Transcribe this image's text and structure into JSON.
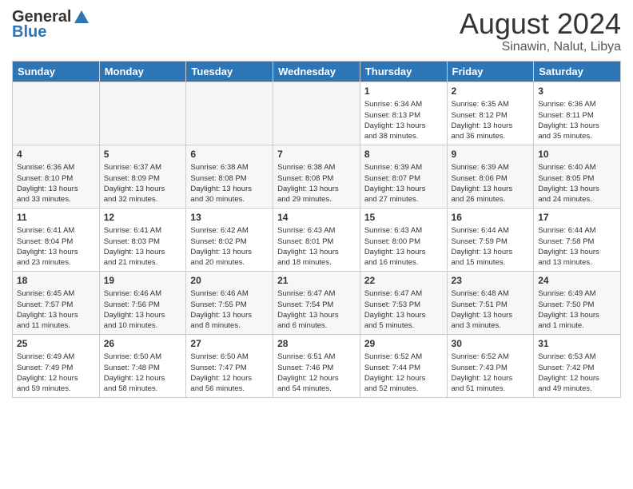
{
  "logo": {
    "general": "General",
    "blue": "Blue"
  },
  "header": {
    "month_year": "August 2024",
    "location": "Sinawin, Nalut, Libya"
  },
  "weekdays": [
    "Sunday",
    "Monday",
    "Tuesday",
    "Wednesday",
    "Thursday",
    "Friday",
    "Saturday"
  ],
  "weeks": [
    [
      {
        "day": "",
        "info": "",
        "empty": true
      },
      {
        "day": "",
        "info": "",
        "empty": true
      },
      {
        "day": "",
        "info": "",
        "empty": true
      },
      {
        "day": "",
        "info": "",
        "empty": true
      },
      {
        "day": "1",
        "info": "Sunrise: 6:34 AM\nSunset: 8:13 PM\nDaylight: 13 hours\nand 38 minutes."
      },
      {
        "day": "2",
        "info": "Sunrise: 6:35 AM\nSunset: 8:12 PM\nDaylight: 13 hours\nand 36 minutes."
      },
      {
        "day": "3",
        "info": "Sunrise: 6:36 AM\nSunset: 8:11 PM\nDaylight: 13 hours\nand 35 minutes."
      }
    ],
    [
      {
        "day": "4",
        "info": "Sunrise: 6:36 AM\nSunset: 8:10 PM\nDaylight: 13 hours\nand 33 minutes."
      },
      {
        "day": "5",
        "info": "Sunrise: 6:37 AM\nSunset: 8:09 PM\nDaylight: 13 hours\nand 32 minutes."
      },
      {
        "day": "6",
        "info": "Sunrise: 6:38 AM\nSunset: 8:08 PM\nDaylight: 13 hours\nand 30 minutes."
      },
      {
        "day": "7",
        "info": "Sunrise: 6:38 AM\nSunset: 8:08 PM\nDaylight: 13 hours\nand 29 minutes."
      },
      {
        "day": "8",
        "info": "Sunrise: 6:39 AM\nSunset: 8:07 PM\nDaylight: 13 hours\nand 27 minutes."
      },
      {
        "day": "9",
        "info": "Sunrise: 6:39 AM\nSunset: 8:06 PM\nDaylight: 13 hours\nand 26 minutes."
      },
      {
        "day": "10",
        "info": "Sunrise: 6:40 AM\nSunset: 8:05 PM\nDaylight: 13 hours\nand 24 minutes."
      }
    ],
    [
      {
        "day": "11",
        "info": "Sunrise: 6:41 AM\nSunset: 8:04 PM\nDaylight: 13 hours\nand 23 minutes."
      },
      {
        "day": "12",
        "info": "Sunrise: 6:41 AM\nSunset: 8:03 PM\nDaylight: 13 hours\nand 21 minutes."
      },
      {
        "day": "13",
        "info": "Sunrise: 6:42 AM\nSunset: 8:02 PM\nDaylight: 13 hours\nand 20 minutes."
      },
      {
        "day": "14",
        "info": "Sunrise: 6:43 AM\nSunset: 8:01 PM\nDaylight: 13 hours\nand 18 minutes."
      },
      {
        "day": "15",
        "info": "Sunrise: 6:43 AM\nSunset: 8:00 PM\nDaylight: 13 hours\nand 16 minutes."
      },
      {
        "day": "16",
        "info": "Sunrise: 6:44 AM\nSunset: 7:59 PM\nDaylight: 13 hours\nand 15 minutes."
      },
      {
        "day": "17",
        "info": "Sunrise: 6:44 AM\nSunset: 7:58 PM\nDaylight: 13 hours\nand 13 minutes."
      }
    ],
    [
      {
        "day": "18",
        "info": "Sunrise: 6:45 AM\nSunset: 7:57 PM\nDaylight: 13 hours\nand 11 minutes."
      },
      {
        "day": "19",
        "info": "Sunrise: 6:46 AM\nSunset: 7:56 PM\nDaylight: 13 hours\nand 10 minutes."
      },
      {
        "day": "20",
        "info": "Sunrise: 6:46 AM\nSunset: 7:55 PM\nDaylight: 13 hours\nand 8 minutes."
      },
      {
        "day": "21",
        "info": "Sunrise: 6:47 AM\nSunset: 7:54 PM\nDaylight: 13 hours\nand 6 minutes."
      },
      {
        "day": "22",
        "info": "Sunrise: 6:47 AM\nSunset: 7:53 PM\nDaylight: 13 hours\nand 5 minutes."
      },
      {
        "day": "23",
        "info": "Sunrise: 6:48 AM\nSunset: 7:51 PM\nDaylight: 13 hours\nand 3 minutes."
      },
      {
        "day": "24",
        "info": "Sunrise: 6:49 AM\nSunset: 7:50 PM\nDaylight: 13 hours\nand 1 minute."
      }
    ],
    [
      {
        "day": "25",
        "info": "Sunrise: 6:49 AM\nSunset: 7:49 PM\nDaylight: 12 hours\nand 59 minutes."
      },
      {
        "day": "26",
        "info": "Sunrise: 6:50 AM\nSunset: 7:48 PM\nDaylight: 12 hours\nand 58 minutes."
      },
      {
        "day": "27",
        "info": "Sunrise: 6:50 AM\nSunset: 7:47 PM\nDaylight: 12 hours\nand 56 minutes."
      },
      {
        "day": "28",
        "info": "Sunrise: 6:51 AM\nSunset: 7:46 PM\nDaylight: 12 hours\nand 54 minutes."
      },
      {
        "day": "29",
        "info": "Sunrise: 6:52 AM\nSunset: 7:44 PM\nDaylight: 12 hours\nand 52 minutes."
      },
      {
        "day": "30",
        "info": "Sunrise: 6:52 AM\nSunset: 7:43 PM\nDaylight: 12 hours\nand 51 minutes."
      },
      {
        "day": "31",
        "info": "Sunrise: 6:53 AM\nSunset: 7:42 PM\nDaylight: 12 hours\nand 49 minutes."
      }
    ]
  ]
}
